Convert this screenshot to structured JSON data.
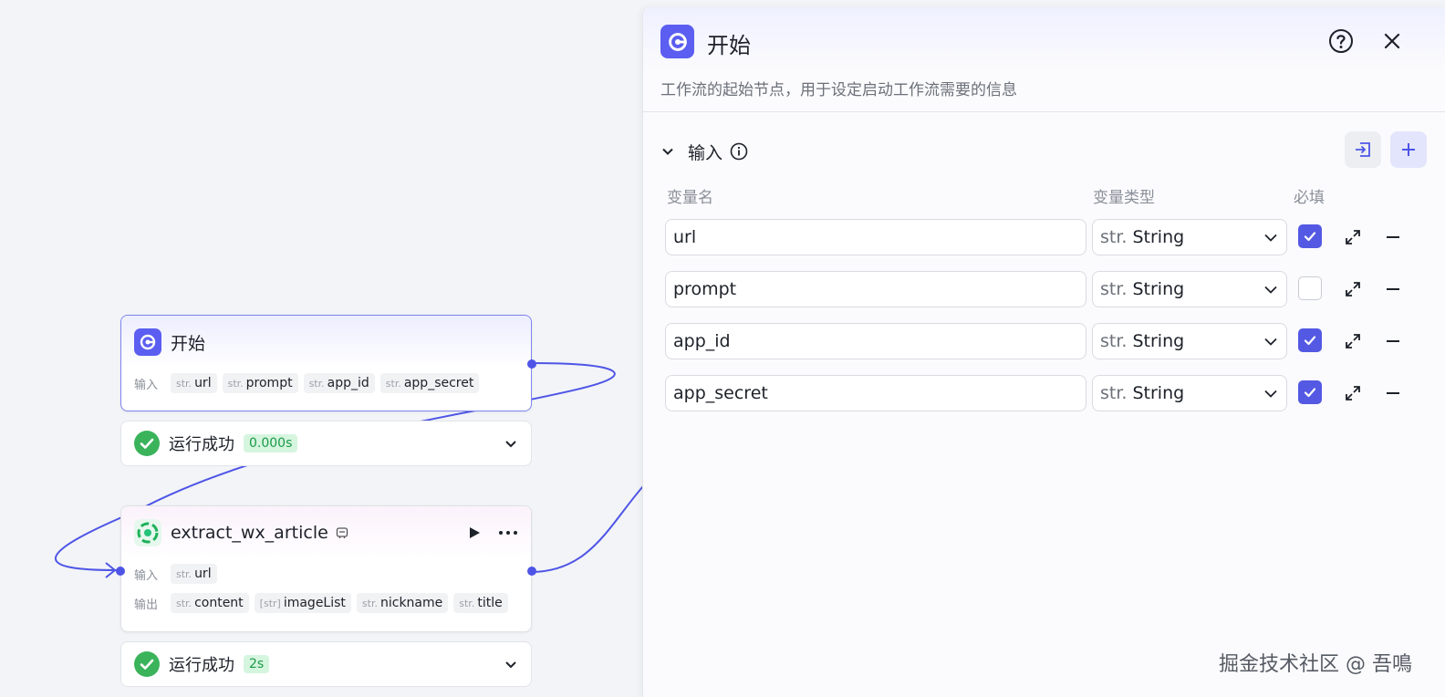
{
  "canvas": {
    "start_node": {
      "title": "开始",
      "input_label": "输入",
      "inputs": [
        {
          "type": "str.",
          "name": "url"
        },
        {
          "type": "str.",
          "name": "prompt"
        },
        {
          "type": "str.",
          "name": "app_id"
        },
        {
          "type": "str.",
          "name": "app_secret"
        }
      ],
      "status": {
        "text": "运行成功",
        "time": "0.000s"
      }
    },
    "plugin_node": {
      "title": "extract_wx_article",
      "input_label": "输入",
      "output_label": "输出",
      "inputs": [
        {
          "type": "str.",
          "name": "url"
        }
      ],
      "outputs": [
        {
          "type": "str.",
          "name": "content"
        },
        {
          "type": "[str]",
          "name": "imageList"
        },
        {
          "type": "str.",
          "name": "nickname"
        },
        {
          "type": "str.",
          "name": "title"
        }
      ],
      "status": {
        "text": "运行成功",
        "time": "2s"
      }
    }
  },
  "panel": {
    "title": "开始",
    "description": "工作流的起始节点，用于设定启动工作流需要的信息",
    "section_title": "输入",
    "columns": {
      "name": "变量名",
      "type": "变量类型",
      "required": "必填"
    },
    "variables": [
      {
        "name": "url",
        "type_prefix": "str.",
        "type_name": "String",
        "required": true
      },
      {
        "name": "prompt",
        "type_prefix": "str.",
        "type_name": "String",
        "required": false
      },
      {
        "name": "app_id",
        "type_prefix": "str.",
        "type_name": "String",
        "required": true
      },
      {
        "name": "app_secret",
        "type_prefix": "str.",
        "type_name": "String",
        "required": true
      }
    ]
  },
  "watermark": "掘金技术社区 @ 吾鳴",
  "colors": {
    "accent": "#5b5ef0",
    "edge": "#4e55e6",
    "success": "#3ab35b",
    "checkbox": "#5459e3"
  }
}
